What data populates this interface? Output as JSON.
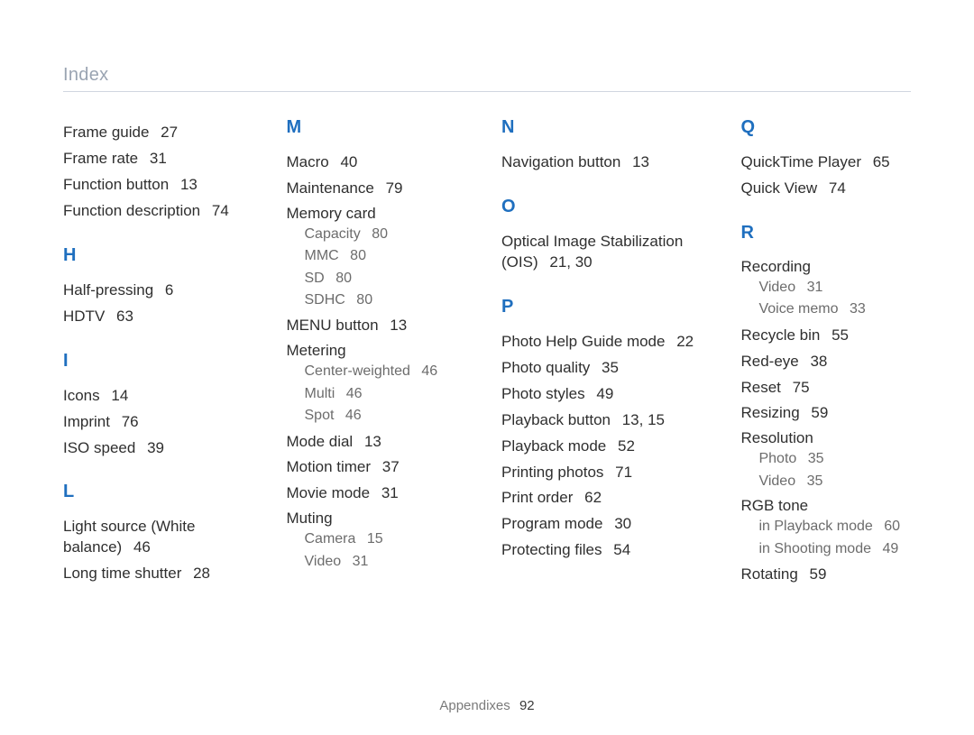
{
  "page_header": "Index",
  "footer": {
    "section": "Appendixes",
    "page": "92"
  },
  "columns": [
    {
      "blocks": [
        {
          "type": "entries",
          "items": [
            {
              "label": "Frame guide",
              "pages": "27"
            },
            {
              "label": "Frame rate",
              "pages": "31"
            },
            {
              "label": "Function button",
              "pages": "13"
            },
            {
              "label": "Function description",
              "pages": "74"
            }
          ]
        },
        {
          "type": "letter",
          "value": "H"
        },
        {
          "type": "entries",
          "items": [
            {
              "label": "Half-pressing",
              "pages": "6"
            },
            {
              "label": "HDTV",
              "pages": "63"
            }
          ]
        },
        {
          "type": "letter",
          "value": "I"
        },
        {
          "type": "entries",
          "items": [
            {
              "label": "Icons",
              "pages": "14"
            },
            {
              "label": "Imprint",
              "pages": "76"
            },
            {
              "label": "ISO speed",
              "pages": "39"
            }
          ]
        },
        {
          "type": "letter",
          "value": "L"
        },
        {
          "type": "entries",
          "items": [
            {
              "label": "Light source (White balance)",
              "pages": "46",
              "multiline": true
            },
            {
              "label": "Long time shutter",
              "pages": "28"
            }
          ]
        }
      ]
    },
    {
      "blocks": [
        {
          "type": "letter",
          "value": "M"
        },
        {
          "type": "entries",
          "items": [
            {
              "label": "Macro",
              "pages": "40"
            },
            {
              "label": "Maintenance",
              "pages": "79"
            }
          ]
        },
        {
          "type": "group",
          "head": "Memory card",
          "subs": [
            {
              "label": "Capacity",
              "pages": "80"
            },
            {
              "label": "MMC",
              "pages": "80"
            },
            {
              "label": "SD",
              "pages": "80"
            },
            {
              "label": "SDHC",
              "pages": "80"
            }
          ]
        },
        {
          "type": "entries",
          "items": [
            {
              "label": "MENU button",
              "pages": "13"
            }
          ]
        },
        {
          "type": "group",
          "head": "Metering",
          "subs": [
            {
              "label": "Center-weighted",
              "pages": "46"
            },
            {
              "label": "Multi",
              "pages": "46"
            },
            {
              "label": "Spot",
              "pages": "46"
            }
          ]
        },
        {
          "type": "entries",
          "items": [
            {
              "label": "Mode dial",
              "pages": "13"
            },
            {
              "label": "Motion timer",
              "pages": "37"
            },
            {
              "label": "Movie mode",
              "pages": "31"
            }
          ]
        },
        {
          "type": "group",
          "head": "Muting",
          "subs": [
            {
              "label": "Camera",
              "pages": "15"
            },
            {
              "label": "Video",
              "pages": "31"
            }
          ]
        }
      ]
    },
    {
      "blocks": [
        {
          "type": "letter",
          "value": "N"
        },
        {
          "type": "entries",
          "items": [
            {
              "label": "Navigation button",
              "pages": "13"
            }
          ]
        },
        {
          "type": "letter",
          "value": "O"
        },
        {
          "type": "entries",
          "items": [
            {
              "label": "Optical Image Stabilization (OIS)",
              "pages": "21, 30",
              "multiline": true
            }
          ]
        },
        {
          "type": "letter",
          "value": "P"
        },
        {
          "type": "entries",
          "items": [
            {
              "label": "Photo Help Guide mode",
              "pages": "22"
            },
            {
              "label": "Photo quality",
              "pages": "35"
            },
            {
              "label": "Photo styles",
              "pages": "49"
            },
            {
              "label": "Playback button",
              "pages": "13, 15"
            },
            {
              "label": "Playback mode",
              "pages": "52"
            },
            {
              "label": "Printing photos",
              "pages": "71"
            },
            {
              "label": "Print order",
              "pages": "62"
            },
            {
              "label": "Program mode",
              "pages": "30"
            },
            {
              "label": "Protecting files",
              "pages": "54"
            }
          ]
        }
      ]
    },
    {
      "blocks": [
        {
          "type": "letter",
          "value": "Q"
        },
        {
          "type": "entries",
          "items": [
            {
              "label": "QuickTime Player",
              "pages": "65"
            },
            {
              "label": "Quick View",
              "pages": "74"
            }
          ]
        },
        {
          "type": "letter",
          "value": "R"
        },
        {
          "type": "group",
          "head": "Recording",
          "subs": [
            {
              "label": "Video",
              "pages": "31"
            },
            {
              "label": "Voice memo",
              "pages": "33"
            }
          ]
        },
        {
          "type": "entries",
          "items": [
            {
              "label": "Recycle bin",
              "pages": "55"
            },
            {
              "label": "Red-eye",
              "pages": "38"
            },
            {
              "label": "Reset",
              "pages": "75"
            },
            {
              "label": "Resizing",
              "pages": "59"
            }
          ]
        },
        {
          "type": "group",
          "head": "Resolution",
          "subs": [
            {
              "label": "Photo",
              "pages": "35"
            },
            {
              "label": "Video",
              "pages": "35"
            }
          ]
        },
        {
          "type": "group",
          "head": "RGB tone",
          "subs": [
            {
              "label": "in Playback mode",
              "pages": "60"
            },
            {
              "label": "in Shooting mode",
              "pages": "49"
            }
          ]
        },
        {
          "type": "entries",
          "items": [
            {
              "label": "Rotating",
              "pages": "59"
            }
          ]
        }
      ]
    }
  ]
}
